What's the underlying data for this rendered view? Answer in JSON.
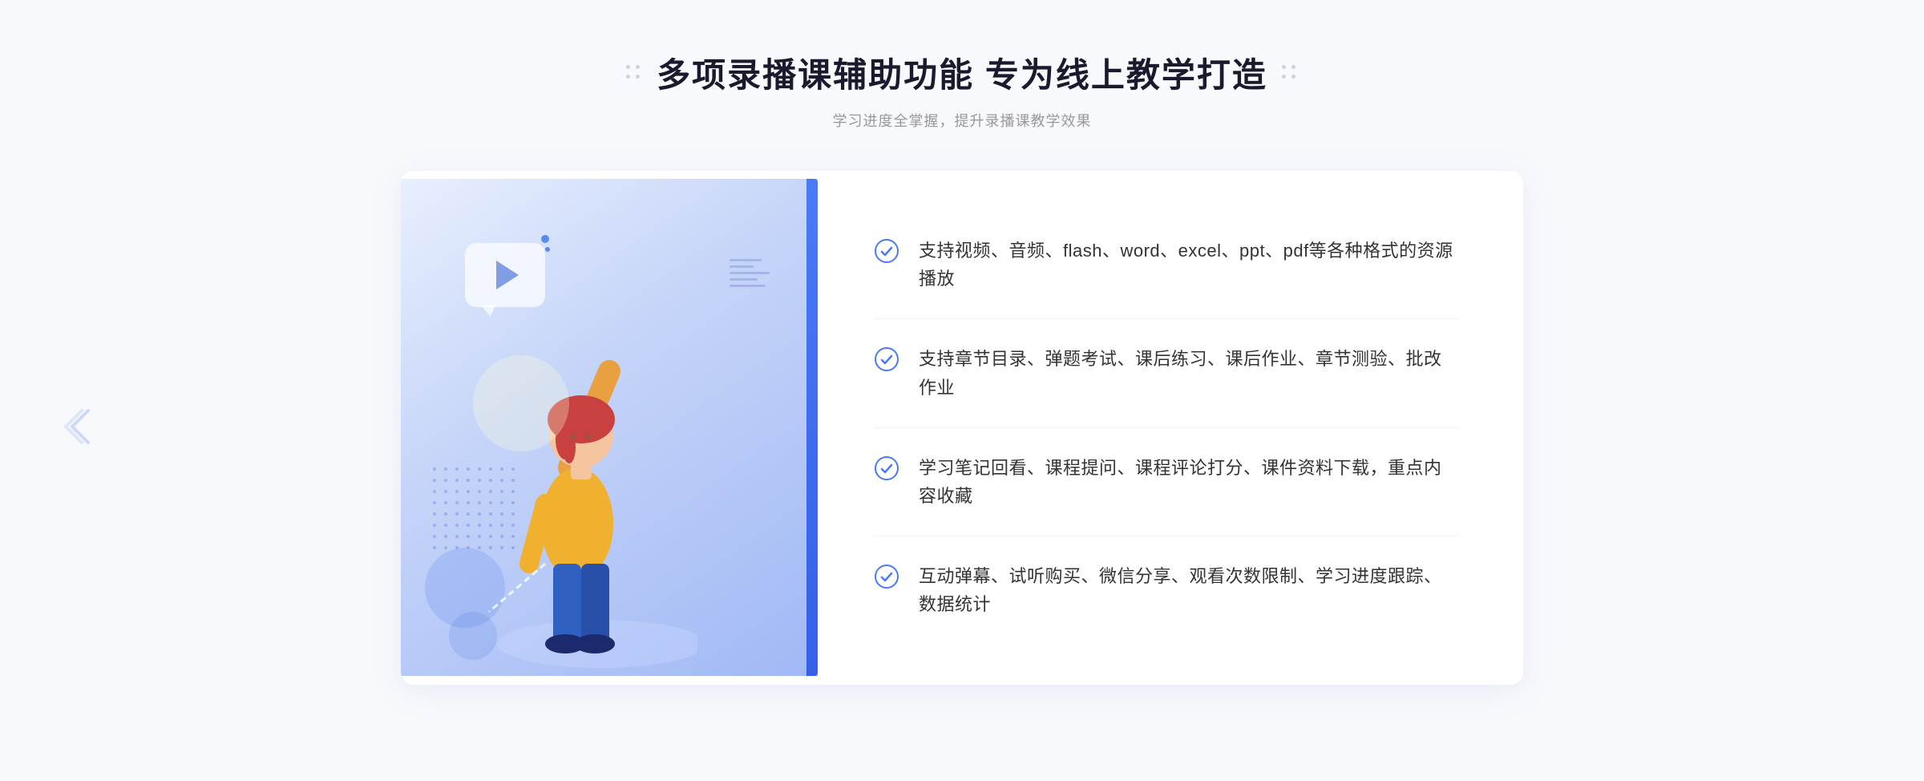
{
  "header": {
    "title": "多项录播课辅助功能 专为线上教学打造",
    "subtitle": "学习进度全掌握，提升录播课教学效果"
  },
  "features": [
    {
      "id": 1,
      "text": "支持视频、音频、flash、word、excel、ppt、pdf等各种格式的资源播放"
    },
    {
      "id": 2,
      "text": "支持章节目录、弹题考试、课后练习、课后作业、章节测验、批改作业"
    },
    {
      "id": 3,
      "text": "学习笔记回看、课程提问、课程评论打分、课件资料下载，重点内容收藏"
    },
    {
      "id": 4,
      "text": "互动弹幕、试听购买、微信分享、观看次数限制、学习进度跟踪、数据统计"
    }
  ],
  "colors": {
    "primary": "#4a7af5",
    "text_dark": "#1a1a2e",
    "text_light": "#999999",
    "text_body": "#333333"
  }
}
